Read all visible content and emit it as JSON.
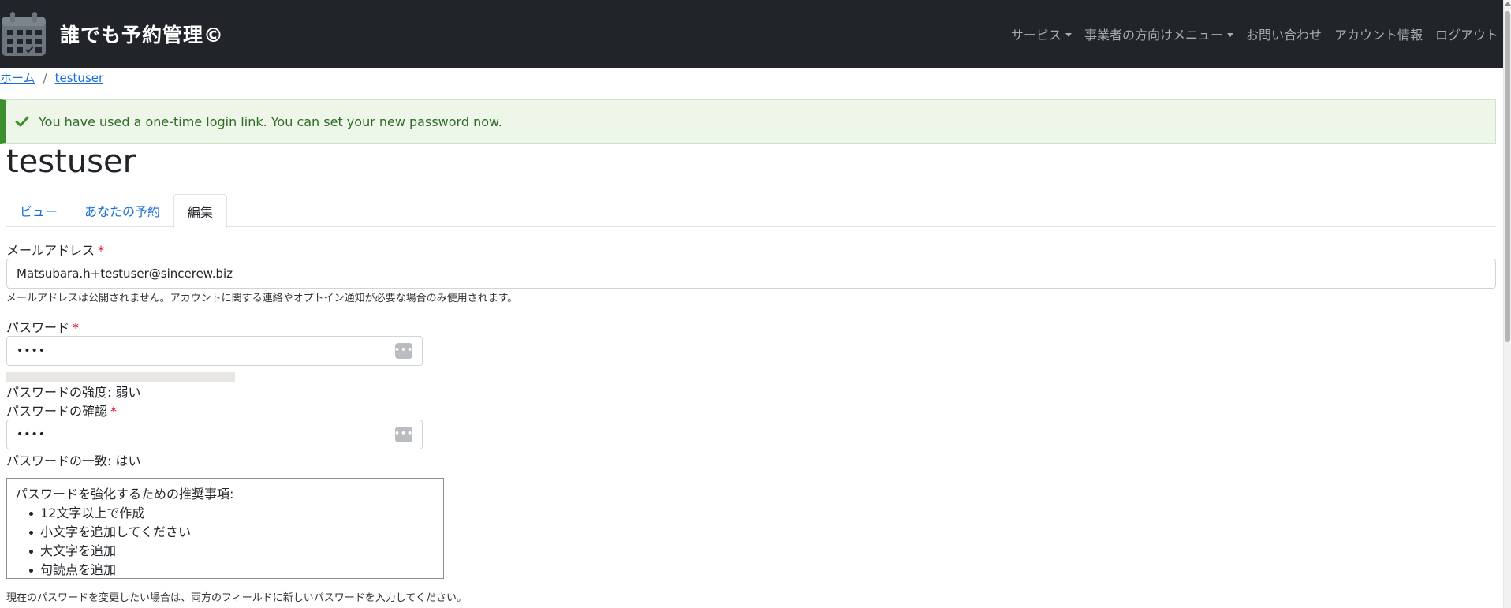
{
  "navbar": {
    "brand": "誰でも予約管理©",
    "links": [
      {
        "label": "サービス",
        "dropdown": true
      },
      {
        "label": "事業者の方向けメニュー",
        "dropdown": true
      },
      {
        "label": "お問い合わせ",
        "dropdown": false
      },
      {
        "label": "アカウント情報",
        "dropdown": false
      },
      {
        "label": "ログアウト",
        "dropdown": false
      }
    ]
  },
  "breadcrumb": {
    "home": "ホーム",
    "separator": "/",
    "user": "testuser"
  },
  "alert": {
    "message": "You have used a one-time login link. You can set your new password now."
  },
  "page_title": "testuser",
  "tabs": [
    {
      "label": "ビュー",
      "active": false
    },
    {
      "label": "あなたの予約",
      "active": false
    },
    {
      "label": "編集",
      "active": true
    }
  ],
  "form": {
    "email": {
      "label": "メールアドレス",
      "required_mark": "*",
      "value": "Matsubara.h+testuser@sincerew.biz",
      "description": "メールアドレスは公開されません。アカウントに関する連絡やオプトイン通知が必要な場合のみ使用されます。"
    },
    "password": {
      "label": "パスワード",
      "required_mark": "*",
      "value": "••••",
      "strength_level": 0.0,
      "strength_label": "パスワードの強度:",
      "strength_value": "弱い"
    },
    "password_confirm": {
      "label": "パスワードの確認",
      "required_mark": "*",
      "value": "••••",
      "match_label": "パスワードの一致:",
      "match_value": "はい"
    },
    "suggestions": {
      "title": "パスワードを強化するための推奨事項:",
      "items": [
        "12文字以上で作成",
        "小文字を追加してください",
        "大文字を追加",
        "句読点を追加"
      ]
    },
    "change_note": "現在のパスワードを変更したい場合は、両方のフィールドに新しいパスワードを入力してください。"
  },
  "colors": {
    "navbar_bg": "#212529",
    "link": "#1a6fd6",
    "alert_border": "#3c8f2e",
    "alert_bg": "#eef6ea",
    "required": "#d0021b"
  },
  "icons": {
    "brand": "calendar-icon",
    "alert": "check-icon",
    "password_manager": "password-key-icon"
  }
}
